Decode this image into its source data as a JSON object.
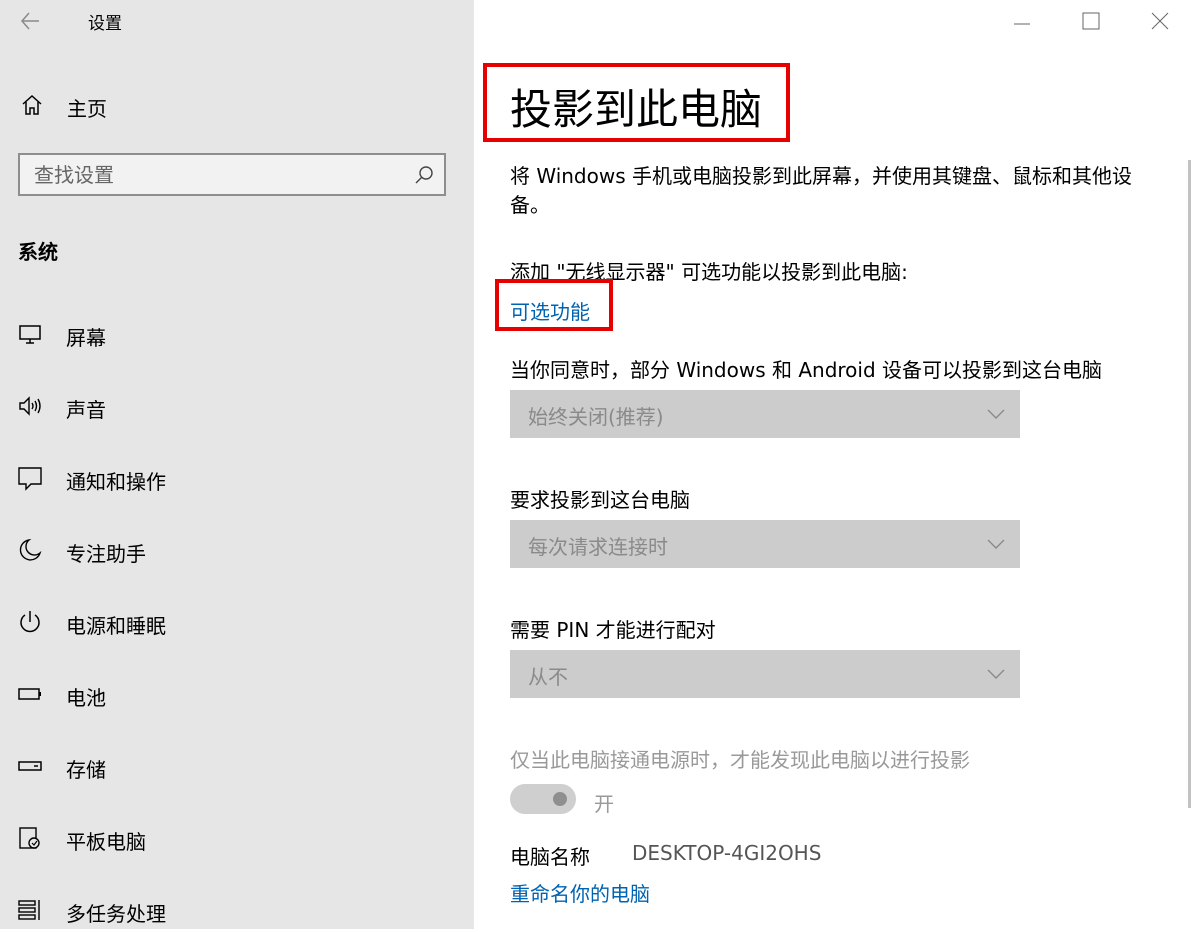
{
  "window": {
    "title": "设置"
  },
  "sidebar": {
    "home_label": "主页",
    "search_placeholder": "查找设置",
    "section_label": "系统",
    "items": [
      {
        "label": "屏幕",
        "icon": "monitor-icon"
      },
      {
        "label": "声音",
        "icon": "speaker-icon"
      },
      {
        "label": "通知和操作",
        "icon": "notification-icon"
      },
      {
        "label": "专注助手",
        "icon": "moon-icon"
      },
      {
        "label": "电源和睡眠",
        "icon": "power-icon"
      },
      {
        "label": "电池",
        "icon": "battery-icon"
      },
      {
        "label": "存储",
        "icon": "storage-icon"
      },
      {
        "label": "平板电脑",
        "icon": "tablet-icon"
      },
      {
        "label": "多任务处理",
        "icon": "multitask-icon"
      }
    ]
  },
  "main": {
    "title": "投影到此电脑",
    "description": "将 Windows 手机或电脑投影到此屏幕，并使用其键盘、鼠标和其他设备。",
    "add_feature_text": "添加 \"无线显示器\" 可选功能以投影到此电脑:",
    "optional_features_link": "可选功能",
    "consent_label": "当你同意时，部分 Windows 和 Android 设备可以投影到这台电脑",
    "consent_value": "始终关闭(推荐)",
    "request_label": "要求投影到这台电脑",
    "request_value": "每次请求连接时",
    "pin_label": "需要 PIN 才能进行配对",
    "pin_value": "从不",
    "power_only_text": "仅当此电脑接通电源时，才能发现此电脑以进行投影",
    "toggle_label": "开",
    "pc_name_label": "电脑名称",
    "pc_name_value": "DESKTOP-4GI2OHS",
    "rename_link": "重命名你的电脑"
  },
  "colors": {
    "sidebar_bg": "#e6e6e6",
    "accent_link": "#0063b1",
    "highlight": "#e60000",
    "dropdown_bg": "#cccccc"
  }
}
